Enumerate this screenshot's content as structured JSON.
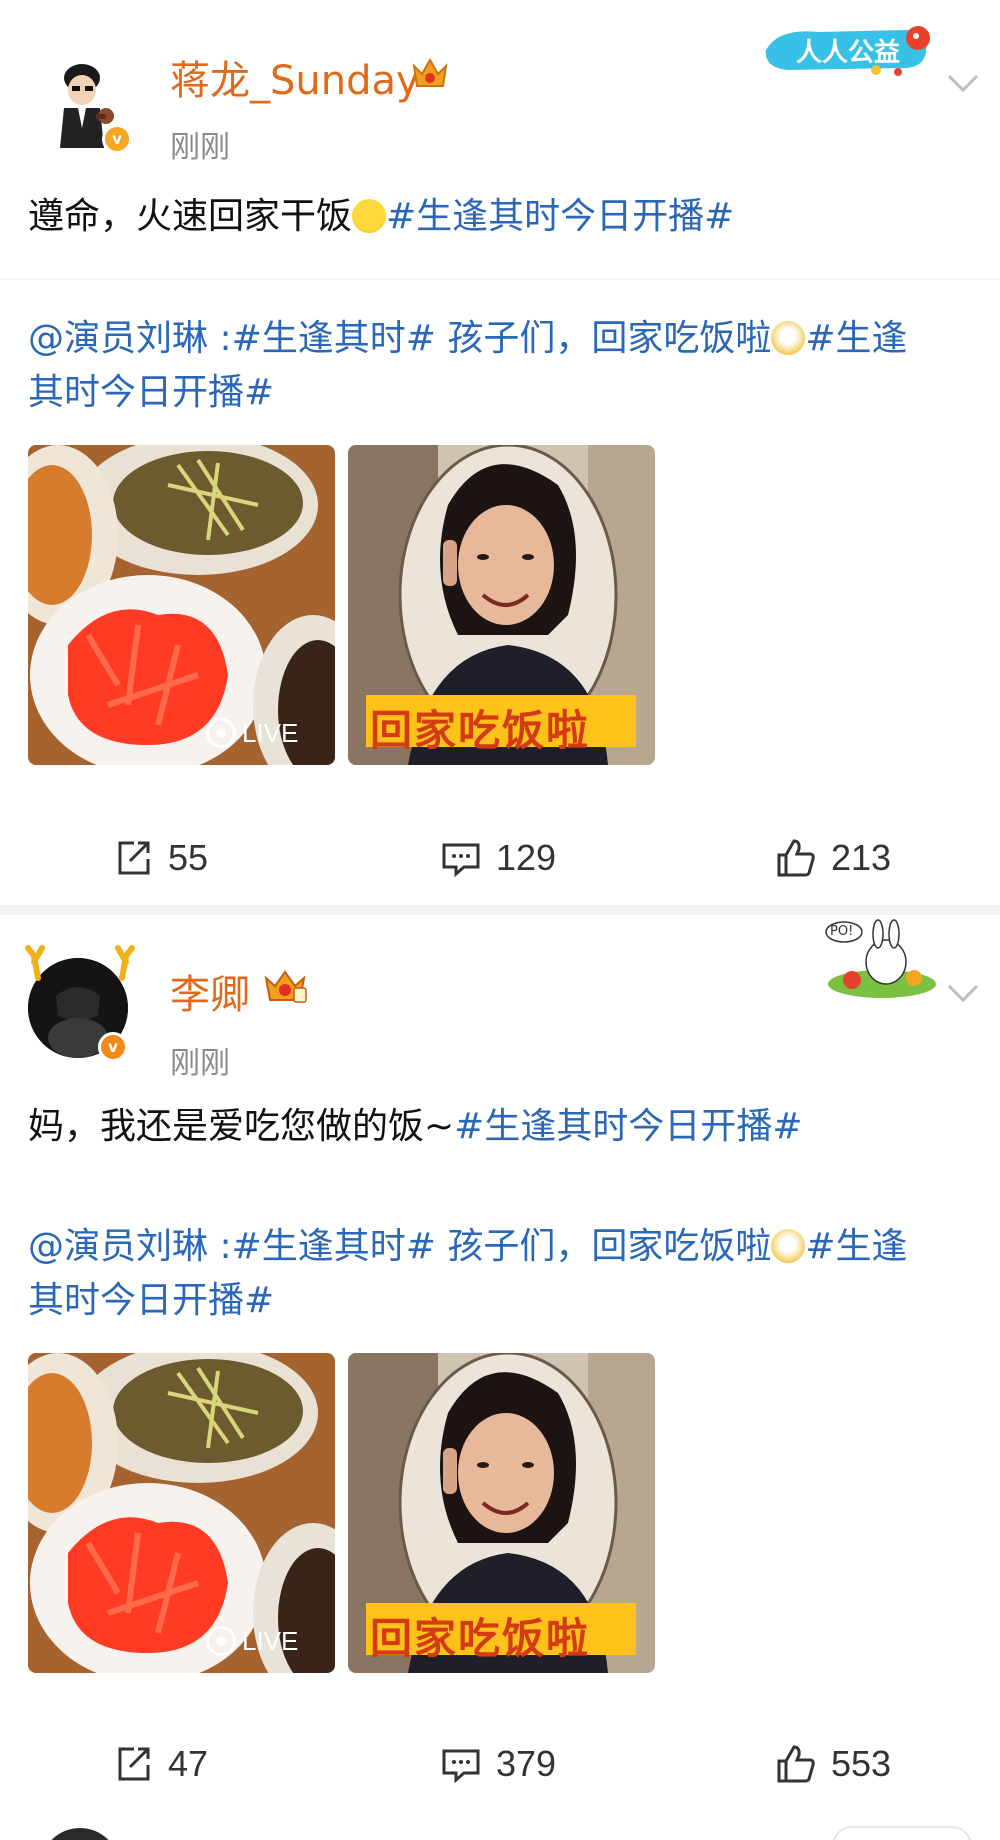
{
  "posts": [
    {
      "username": "蒋龙_Sunday",
      "time": "刚刚",
      "text_main": "遵命，火速回家干饭",
      "text_tag": "#生逢其时今日开播#",
      "decor_badge_text": "人人公益",
      "quote": {
        "at": "@演员刘琳",
        "line1_a": " :#生逢其时# 孩子们，回家吃饭啦",
        "line1_b": "#生逢",
        "line2": "其时今日开播#"
      },
      "images": [
        {
          "live_label": "LIVE"
        },
        {
          "caption": "回家吃饭啦"
        }
      ],
      "actions": {
        "repost": "55",
        "comment": "129",
        "like": "213"
      }
    },
    {
      "username": "李卿",
      "time": "刚刚",
      "text_main": "妈，我还是爱吃您做的饭~",
      "text_tag": "#生逢其时今日开播#",
      "decor_badge_text": "PO!",
      "quote": {
        "at": "@演员刘琳",
        "line1_a": " :#生逢其时# 孩子们，回家吃饭啦",
        "line1_b": "#生逢",
        "line2": "其时今日开播#"
      },
      "images": [
        {
          "live_label": "LIVE"
        },
        {
          "caption": "回家吃饭啦"
        }
      ],
      "actions": {
        "repost": "47",
        "comment": "379",
        "like": "553"
      }
    }
  ],
  "colors": {
    "username": "#e06a1b",
    "topic_link": "#2a67b6",
    "time": "#8a8a8a",
    "verified_badge": "#f5a623"
  }
}
